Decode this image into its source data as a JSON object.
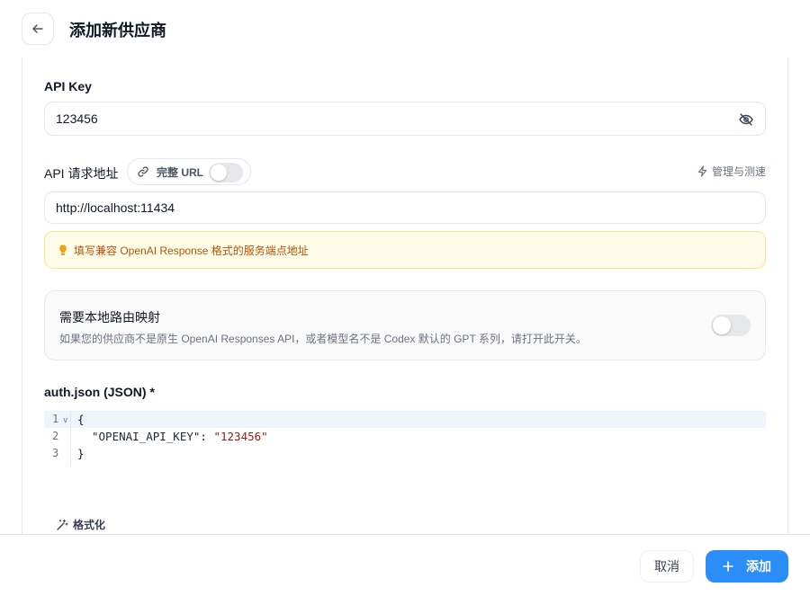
{
  "header": {
    "title": "添加新供应商"
  },
  "api_key": {
    "label": "API Key",
    "value": "123456"
  },
  "api_url": {
    "label": "API 请求地址",
    "full_url_label": "完整 URL",
    "full_url_enabled": false,
    "manage_label": "管理与测速",
    "value": "http://localhost:11434",
    "hint": "填写兼容 OpenAI Response 格式的服务端点地址"
  },
  "mapping": {
    "title": "需要本地路由映射",
    "description": "如果您的供应商不是原生 OpenAI Responses API，或者模型名不是 Codex 默认的 GPT 系列，请打开此开关。",
    "enabled": false
  },
  "auth": {
    "label": "auth.json (JSON) *",
    "lines": [
      {
        "num": "1",
        "text": "{"
      },
      {
        "num": "2",
        "key": "\"OPENAI_API_KEY\"",
        "sep": ": ",
        "value": "\"123456\""
      },
      {
        "num": "3",
        "text": "}"
      }
    ],
    "format_label": "格式化"
  },
  "footer": {
    "cancel_label": "取消",
    "add_label": "添加"
  },
  "colors": {
    "primary": "#2b8ef8",
    "hint_bg": "#fefce8",
    "hint_text": "#b45309"
  }
}
